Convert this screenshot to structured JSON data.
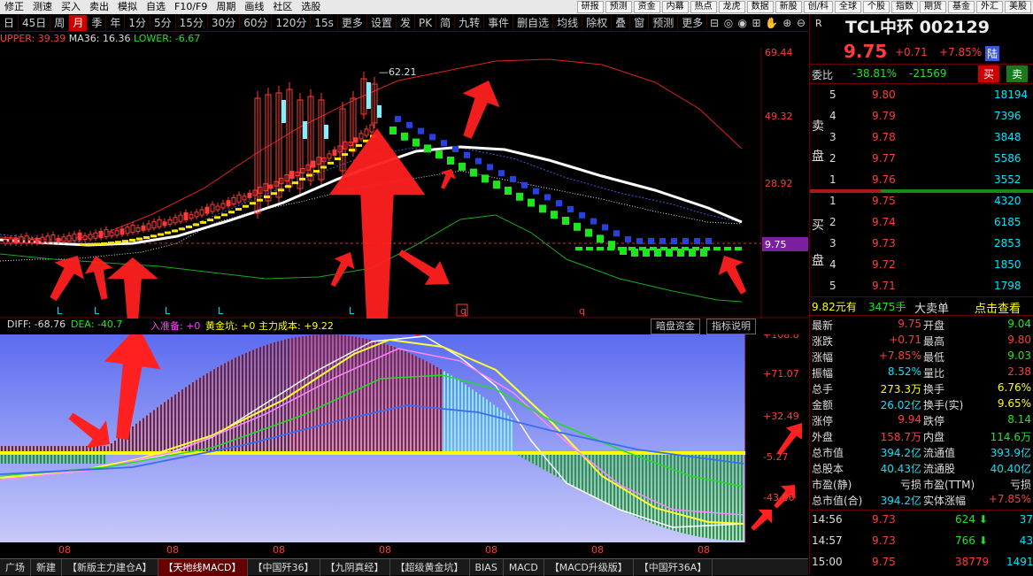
{
  "menu": {
    "items": [
      "修正",
      "测速",
      "买入",
      "卖出",
      "模拟",
      "自选",
      "F10/F9",
      "周期",
      "画线",
      "社区",
      "选股"
    ],
    "buttons": [
      "研报",
      "预测",
      "资金",
      "内幕",
      "热点",
      "龙虎",
      "数据",
      "新股",
      "创/科",
      "全球",
      "个股",
      "指数",
      "期货",
      "基金",
      "外汇",
      "美股"
    ]
  },
  "toolbar": {
    "periods": [
      "日",
      "45日",
      "周",
      "月",
      "季",
      "年",
      "1分",
      "5分",
      "15分",
      "30分",
      "60分",
      "120分",
      "15s",
      "更多",
      "设置"
    ],
    "active": "月",
    "right": [
      "发",
      "PK",
      "简",
      "九转",
      "事件",
      "删自选",
      "均线",
      "除权",
      "叠",
      "窗",
      "预测",
      "更多"
    ]
  },
  "indicators": {
    "upper": "UPPER: 39.39",
    "ma": "MA36: 16.36",
    "lower": "LOWER: -6.67"
  },
  "main_axis": [
    "69.44",
    "49.32",
    "28.92",
    "9.75"
  ],
  "peak_label": "62.21",
  "markers": [
    "L",
    "L",
    "L",
    "L",
    "L",
    "q",
    "q"
  ],
  "macd_line": {
    "diff": "DIFF: -68.76",
    "dea": "DEA: -40.7",
    "zhunbei": "入准备: +0",
    "gold": "黄金坑: +0",
    "cost": "主力成本: +9.22"
  },
  "macd_tabs": [
    "暗盘资金",
    "指标说明"
  ],
  "macd_axis": [
    "+108.8",
    "+71.07",
    "+32.49",
    "-5.27",
    "-43.86"
  ],
  "date_ticks": [
    "08",
    "08",
    "08",
    "08",
    "08",
    "08",
    "08"
  ],
  "bottom_tabs": [
    "广场",
    "新建",
    "【新版主力建仓A】",
    "【天地线MACD】",
    "【中国歼36】",
    "【九阴真经】",
    "【超级黄金坑】",
    "BIAS",
    "MACD",
    "【MACD升级版】",
    "【中国歼36A】"
  ],
  "bottom_active": "【天地线MACD】",
  "quote": {
    "badge": "R",
    "name": "TCL中环 002129",
    "price": "9.75",
    "change": "+0.71",
    "pct": "+7.85%",
    "flag": "陆",
    "weibi_label": "委比",
    "weibi_pct": "-38.81%",
    "weibi_num": "-21569",
    "buy_btn": "买",
    "sell_btn": "卖",
    "sell_label": [
      "卖",
      "盘"
    ],
    "buy_label": [
      "买",
      "盘"
    ],
    "asks": [
      {
        "lv": "5",
        "p": "9.80",
        "v": "18194"
      },
      {
        "lv": "4",
        "p": "9.79",
        "v": "7396"
      },
      {
        "lv": "3",
        "p": "9.78",
        "v": "3848"
      },
      {
        "lv": "2",
        "p": "9.77",
        "v": "5586"
      },
      {
        "lv": "1",
        "p": "9.76",
        "v": "3552"
      }
    ],
    "bids": [
      {
        "lv": "1",
        "p": "9.75",
        "v": "4320"
      },
      {
        "lv": "2",
        "p": "9.74",
        "v": "6185"
      },
      {
        "lv": "3",
        "p": "9.73",
        "v": "2853"
      },
      {
        "lv": "4",
        "p": "9.72",
        "v": "1850"
      },
      {
        "lv": "5",
        "p": "9.71",
        "v": "1798"
      }
    ],
    "big": {
      "a": "9.82元有",
      "b": "3475手",
      "c": "大卖单",
      "d": "点击查看"
    },
    "stats": [
      [
        "最新",
        "9.75",
        "red",
        "开盘",
        "9.04",
        "green"
      ],
      [
        "涨跌",
        "+0.71",
        "red",
        "最高",
        "9.80",
        "red"
      ],
      [
        "涨幅",
        "+7.85%",
        "red",
        "最低",
        "9.03",
        "green"
      ],
      [
        "振幅",
        "8.52%",
        "cyan",
        "量比",
        "2.38",
        "red"
      ],
      [
        "总手",
        "273.3万",
        "yel",
        "换手",
        "6.76%",
        "yel"
      ],
      [
        "金额",
        "26.02亿",
        "cyan",
        "换手(实)",
        "9.65%",
        "yel"
      ],
      [
        "涨停",
        "9.94",
        "red",
        "跌停",
        "8.14",
        "green"
      ],
      [
        "外盘",
        "158.7万",
        "red",
        "内盘",
        "114.6万",
        "green"
      ],
      [
        "总市值",
        "394.2亿",
        "cyan",
        "流通值",
        "393.9亿",
        "cyan"
      ],
      [
        "总股本",
        "40.43亿",
        "cyan",
        "流通股",
        "40.40亿",
        "cyan"
      ],
      [
        "市盈(静)",
        "亏损",
        "white",
        "市盈(TTM)",
        "亏损",
        "white"
      ],
      [
        "总市值(合)",
        "394.2亿",
        "cyan",
        "实体涨幅",
        "+7.85%",
        "red"
      ]
    ],
    "ticks": [
      {
        "t": "14:56",
        "p": "9.73",
        "v": "624",
        "n": "37"
      },
      {
        "t": "14:57",
        "p": "9.73",
        "v": "766",
        "n": "43"
      },
      {
        "t": "15:00",
        "p": "9.75",
        "v": "38779",
        "n": "1491"
      }
    ]
  },
  "colors": {
    "up": "#ff3b3b",
    "down": "#1ee61e",
    "accent": "#cc0000"
  }
}
